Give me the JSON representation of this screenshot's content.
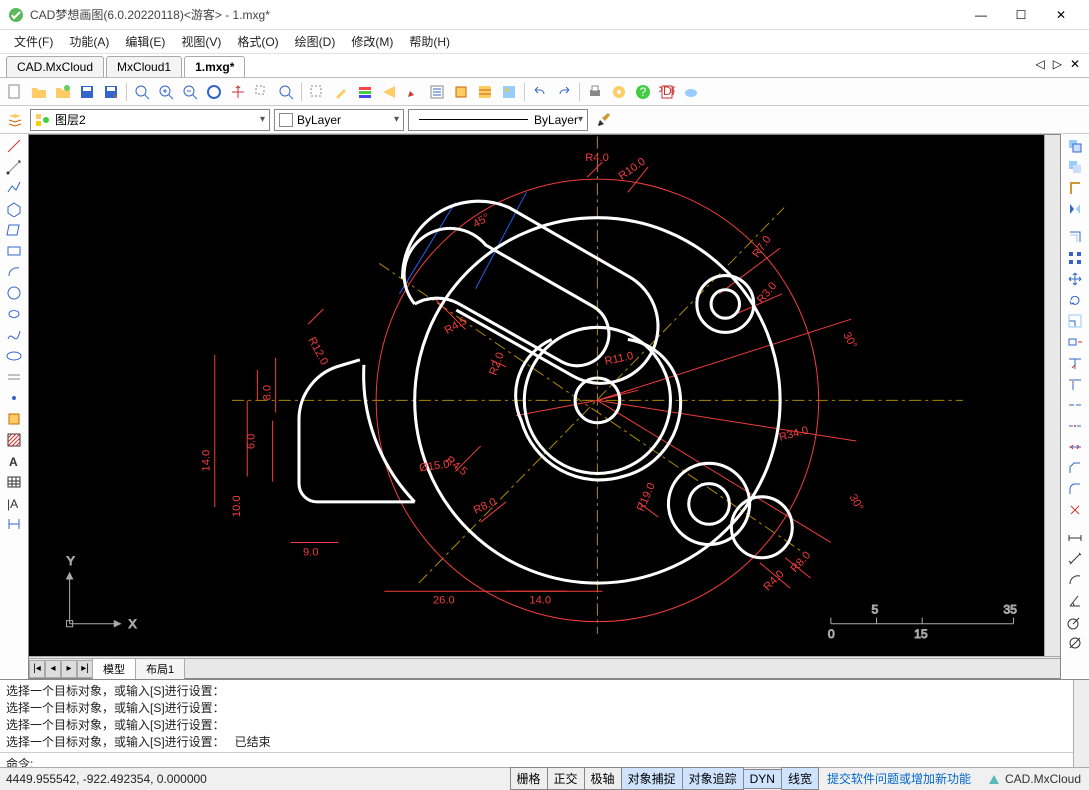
{
  "window": {
    "title": "CAD梦想画图(6.0.20220118)<游客> - 1.mxg*",
    "min": "—",
    "max": "☐",
    "close": "✕"
  },
  "menu": {
    "items": [
      "文件(F)",
      "功能(A)",
      "编辑(E)",
      "视图(V)",
      "格式(O)",
      "绘图(D)",
      "修改(M)",
      "帮助(H)"
    ]
  },
  "tabs": {
    "items": [
      "CAD.MxCloud",
      "MxCloud1",
      "1.mxg*"
    ],
    "active": 2
  },
  "layerrow": {
    "layer_label": "图层2",
    "color_label": "ByLayer",
    "linetype_label": "ByLayer"
  },
  "sheets": {
    "items": [
      "模型",
      "布局1"
    ],
    "active": 0
  },
  "console": {
    "history": [
      "选择一个目标对象，或输入[S]进行设置：",
      "选择一个目标对象，或输入[S]进行设置：",
      "选择一个目标对象，或输入[S]进行设置：",
      "选择一个目标对象，或输入[S]进行设置：   已结束"
    ],
    "cmd_label": "命令:"
  },
  "status": {
    "coords": "4449.955542, -922.492354, 0.000000",
    "toggles": [
      "栅格",
      "正交",
      "极轴",
      "对象捕捉",
      "对象追踪",
      "DYN",
      "线宽"
    ],
    "toggles_active": [
      false,
      false,
      false,
      true,
      true,
      true,
      true
    ],
    "link": "提交软件问题或增加新功能",
    "brand": "CAD.MxCloud"
  },
  "dims": {
    "r4": "R4.0",
    "r10": "R10.0",
    "ang45": "45°",
    "r7": "R7.0",
    "r3": "R3.0",
    "ang30a": "30°",
    "r34": "R34.0",
    "ang30b": "30°",
    "r8b": "R8.0",
    "r4b": "R4.0",
    "r8a": "R8.0",
    "r19": "R19.0",
    "r11": "R11.0",
    "r2": "R2.0",
    "r45a": "R4.5",
    "r45b": "R4.5",
    "d15": "Ø15.0",
    "r12": "R12.0",
    "d8": "8.0",
    "d6": "6.0",
    "d14v": "14.0",
    "d10": "10.0",
    "d9": "9.0",
    "d26": "26.0",
    "d14h": "14.0"
  },
  "ruler": {
    "t0": "0",
    "t5": "5",
    "t15": "15",
    "t35": "35"
  },
  "axes": {
    "x": "X",
    "y": "Y"
  }
}
